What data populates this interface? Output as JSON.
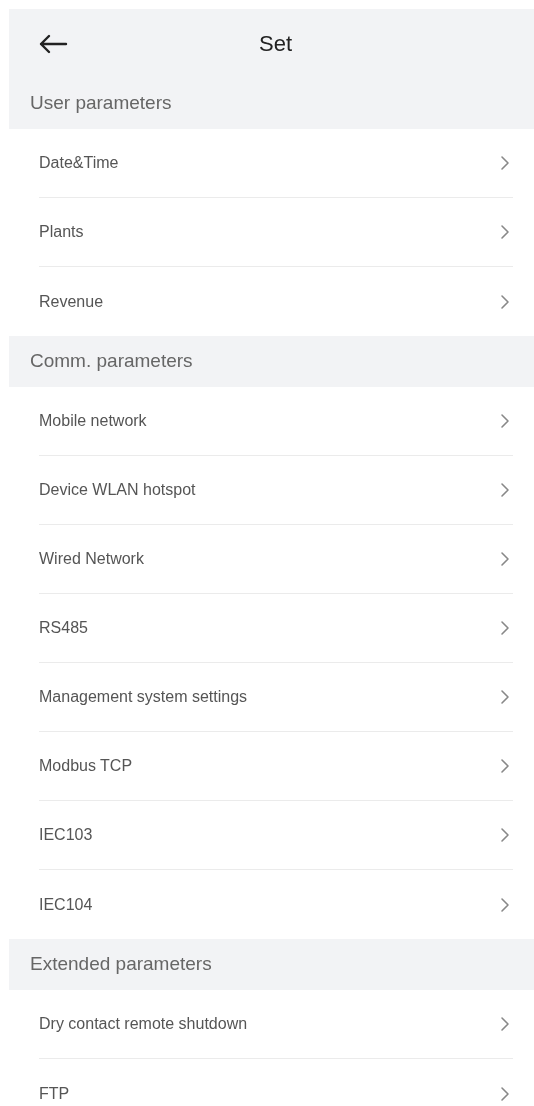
{
  "header": {
    "title": "Set"
  },
  "sections": [
    {
      "title": "User parameters",
      "items": [
        {
          "label": "Date&Time"
        },
        {
          "label": "Plants"
        },
        {
          "label": "Revenue"
        }
      ]
    },
    {
      "title": "Comm. parameters",
      "items": [
        {
          "label": "Mobile network"
        },
        {
          "label": "Device WLAN hotspot"
        },
        {
          "label": "Wired Network"
        },
        {
          "label": "RS485"
        },
        {
          "label": "Management system settings"
        },
        {
          "label": "Modbus TCP"
        },
        {
          "label": "IEC103"
        },
        {
          "label": "IEC104"
        }
      ]
    },
    {
      "title": "Extended parameters",
      "items": [
        {
          "label": "Dry contact remote shutdown"
        },
        {
          "label": "FTP"
        }
      ]
    }
  ]
}
